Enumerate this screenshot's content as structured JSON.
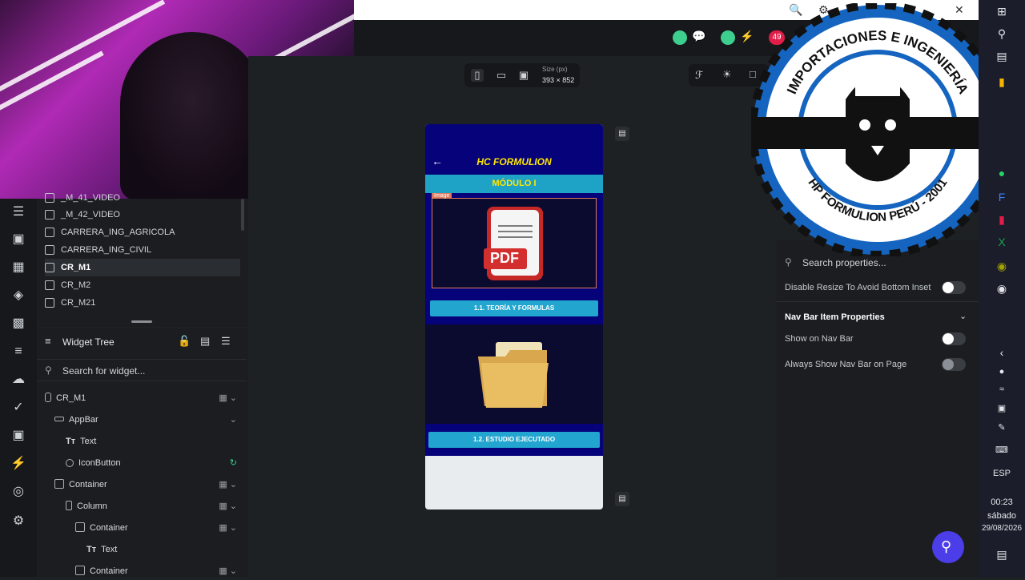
{
  "device": {
    "size_label": "Size (px)",
    "size_value": "393 × 852"
  },
  "notifications": {
    "badge_count": "49"
  },
  "page_list": [
    "_M_41_VIDEO",
    "_M_42_VIDEO",
    "CARRERA_ING_AGRICOLA",
    "CARRERA_ING_CIVIL",
    "CR_M1",
    "CR_M2",
    "CR_M21"
  ],
  "widget_tree": {
    "title": "Widget Tree",
    "search_placeholder": "Search for widget...",
    "nodes": [
      {
        "label": "CR_M1"
      },
      {
        "label": "AppBar"
      },
      {
        "label": "Text"
      },
      {
        "label": "IconButton"
      },
      {
        "label": "Container"
      },
      {
        "label": "Column"
      },
      {
        "label": "Container"
      },
      {
        "label": "Text"
      },
      {
        "label": "Container"
      }
    ]
  },
  "phone": {
    "appbar_title": "HC FORMULION",
    "module_title": "MÓDULO I",
    "image_tag": "Image",
    "pdf_label": "PDF",
    "button1": "1.1. TEORÍA Y FORMULAS",
    "button2": "1.2. ESTUDIO EJECUTADO"
  },
  "properties": {
    "search_placeholder": "Search properties...",
    "disable_resize": "Disable Resize To Avoid Bottom Inset",
    "nav_bar_section": "Nav Bar Item Properties",
    "show_on_nav_bar": "Show on Nav Bar",
    "always_show_nav_bar": "Always Show Nav Bar on Page"
  },
  "logo": {
    "top_text": "IMPORTACIONES E INGENIERÍA",
    "bottom_text": "HP FORMULION PERÚ - 2001"
  },
  "taskbar": {
    "language": "ESP",
    "time": "00:23",
    "day": "sábado",
    "date": "29/08/2026"
  },
  "colors": {
    "appbar": "#05027a",
    "module_bar": "#1ea3c7",
    "title_yellow": "#ffe600",
    "button": "#22a6cf"
  }
}
